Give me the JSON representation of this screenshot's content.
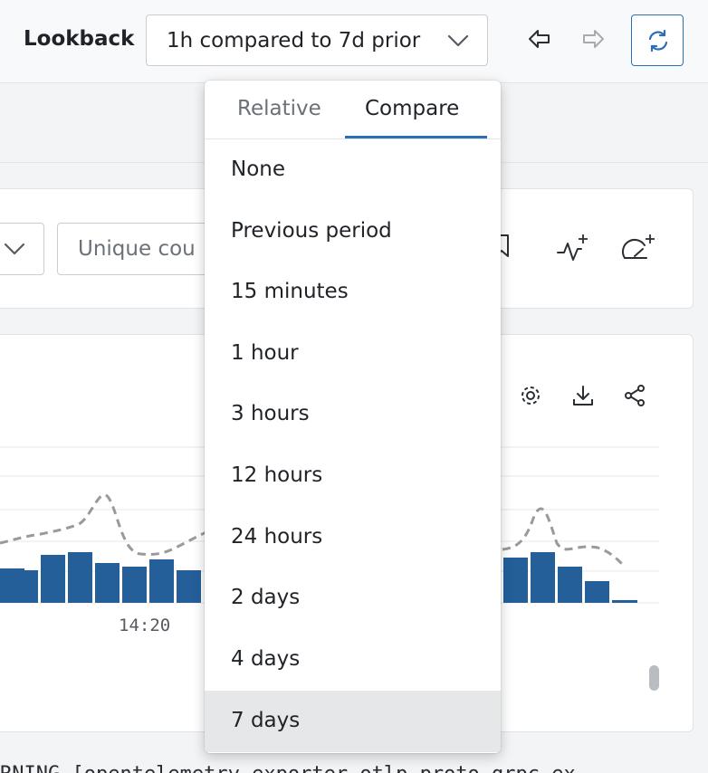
{
  "header": {
    "lookback_label": "Lookback",
    "lookback_value": "1h compared to 7d prior"
  },
  "query": {
    "input_placeholder": "Unique cou"
  },
  "chart": {
    "tick_label": "14:20",
    "accent": "#245f99",
    "dashed": "#9a9a9a"
  },
  "log": {
    "line": "RNING [opentelemetry.exporter.otlp.proto.grpc.ex"
  },
  "dropdown": {
    "tabs": [
      {
        "label": "Relative"
      },
      {
        "label": "Compare"
      }
    ],
    "options": [
      {
        "label": "None"
      },
      {
        "label": "Previous period"
      },
      {
        "label": "15 minutes"
      },
      {
        "label": "1 hour"
      },
      {
        "label": "3 hours"
      },
      {
        "label": "12 hours"
      },
      {
        "label": "24 hours"
      },
      {
        "label": "2 days"
      },
      {
        "label": "4 days"
      },
      {
        "label": "7 days"
      }
    ]
  }
}
